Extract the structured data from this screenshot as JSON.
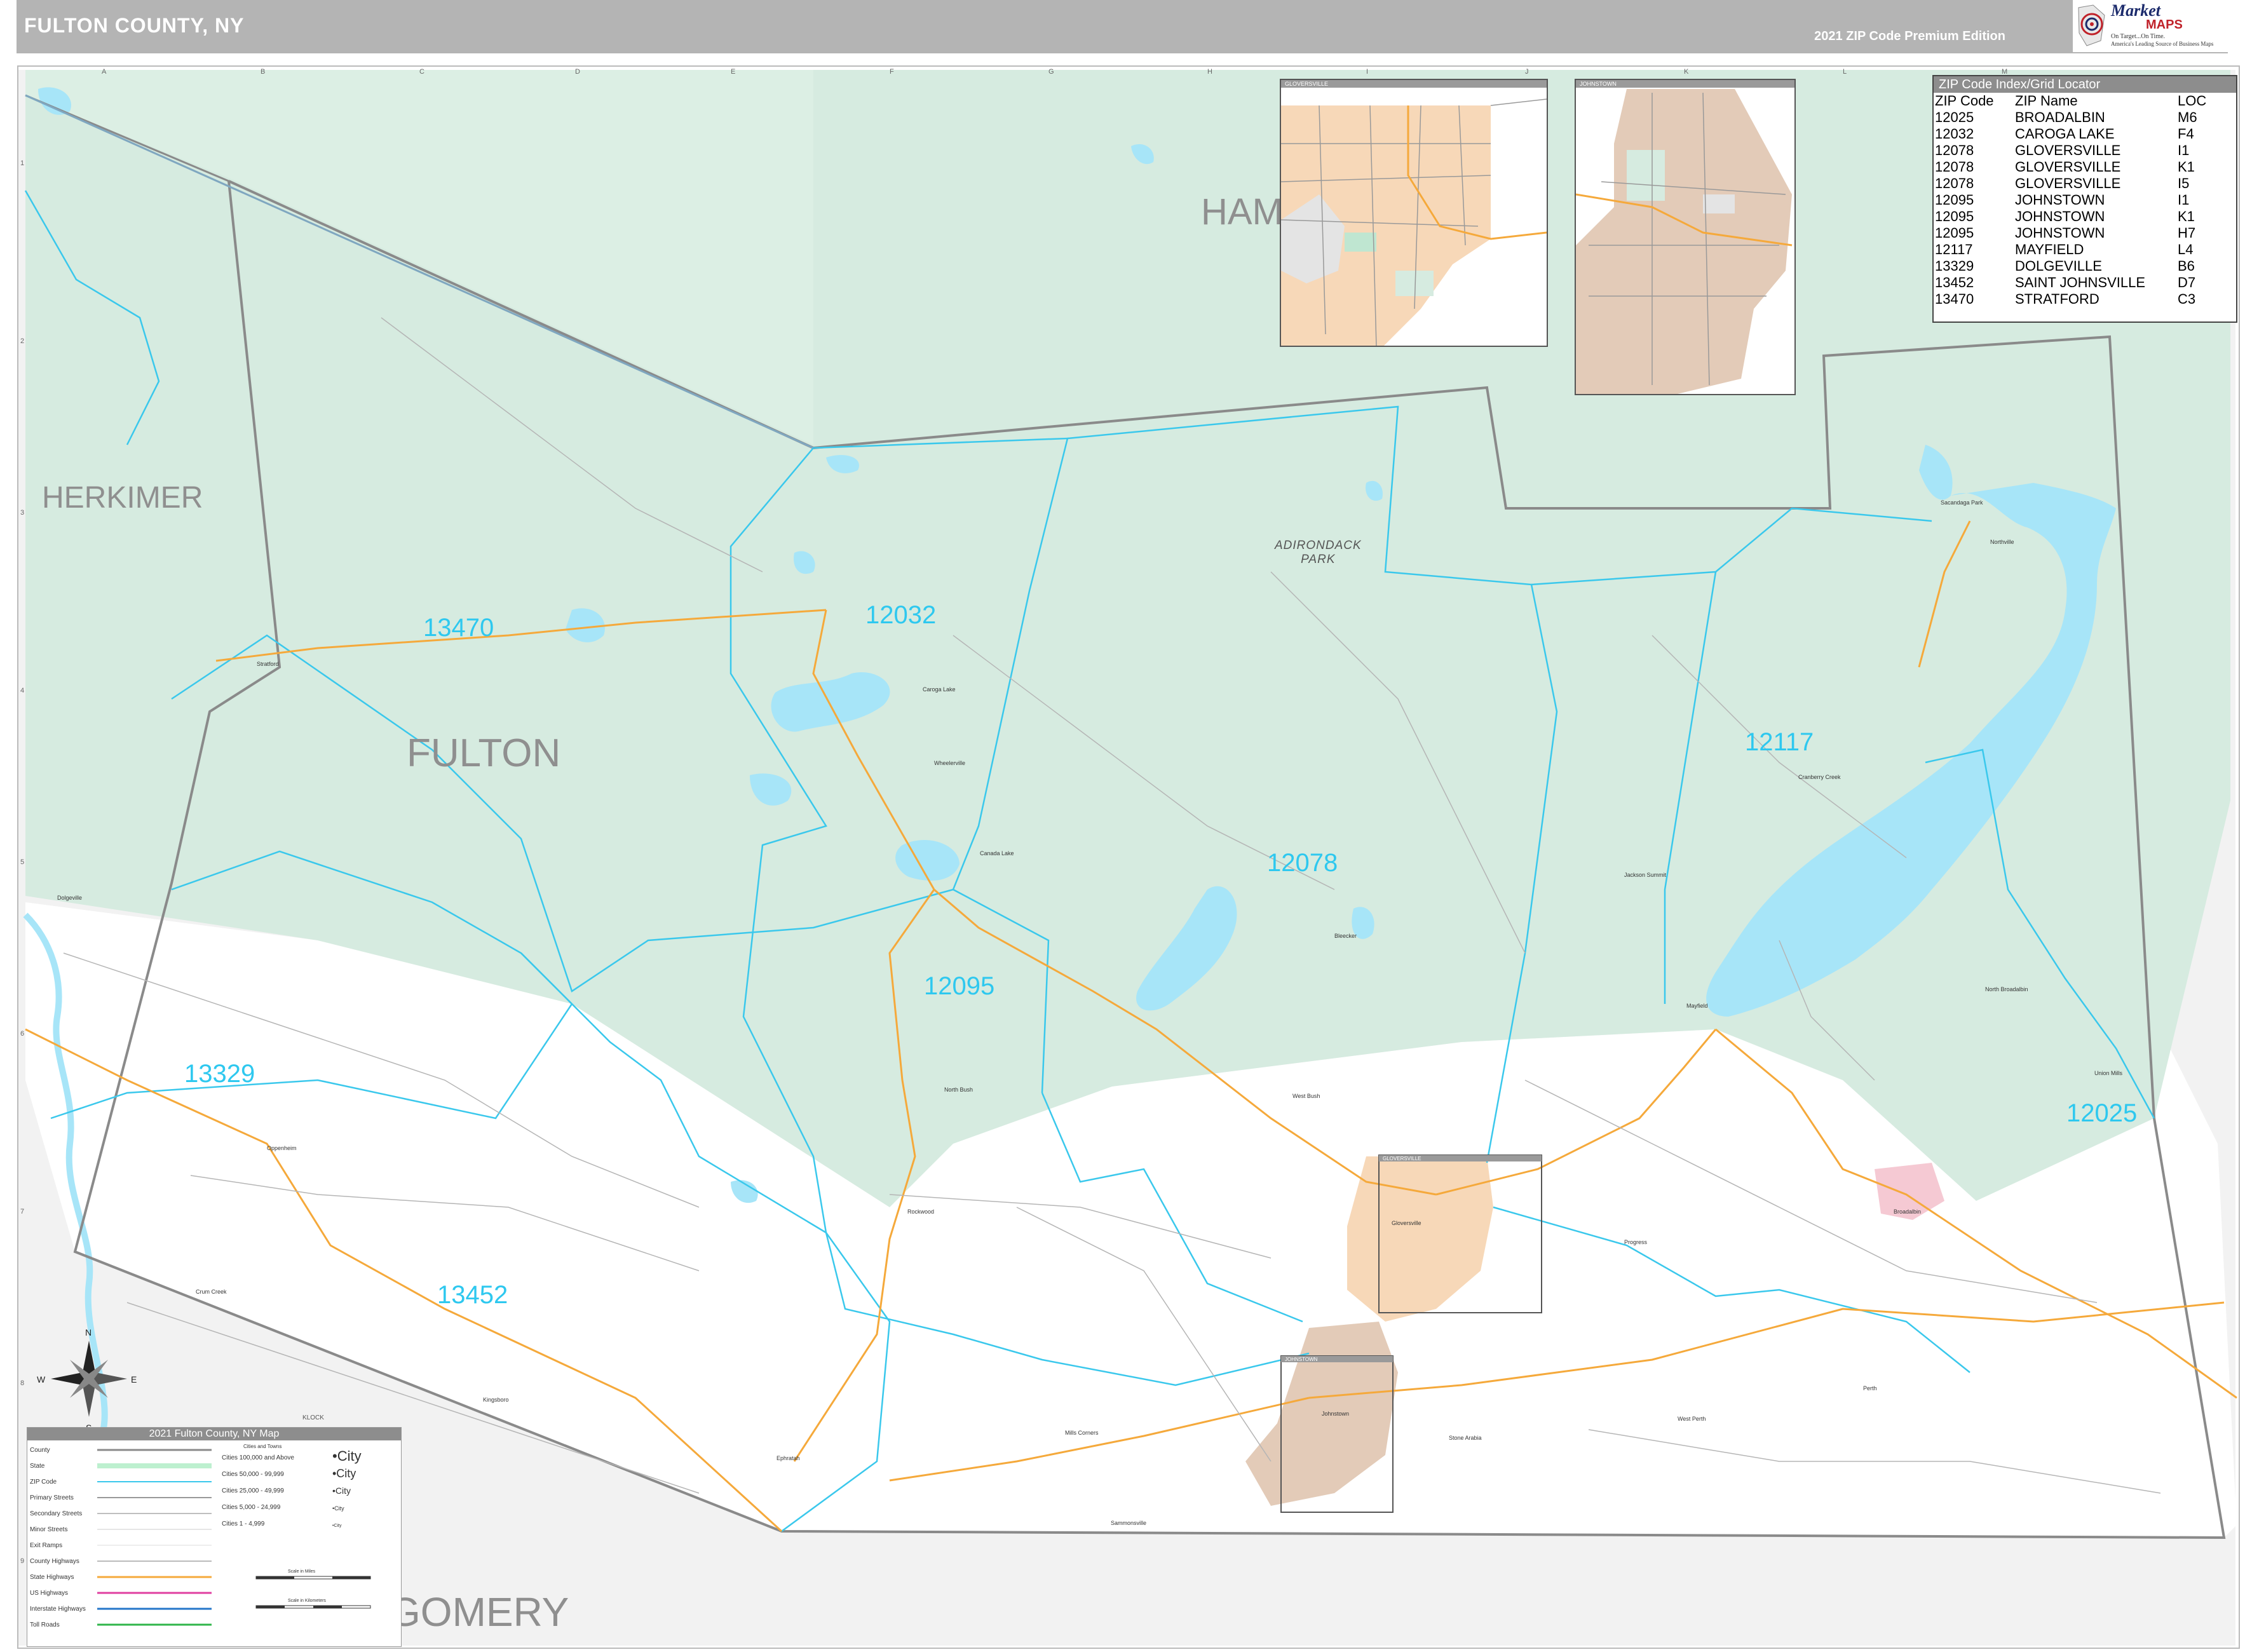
{
  "header": {
    "title": "FULTON COUNTY, NY",
    "edition": "2021 ZIP Code Premium Edition"
  },
  "logo": {
    "brand_top": "Market",
    "brand_bottom": "MAPS",
    "tagline_1": "On Target...On Time.",
    "tagline_2": "America's Leading Source of Business Maps",
    "icon": "target-map-icon"
  },
  "colors": {
    "adirondack_park": "#d6ebe0",
    "water": "#a7e5f8",
    "zip_boundary": "#3ac8ec",
    "zip_label": "#2ec8ef",
    "county_boundary": "#8a8a8a",
    "city_fill": "#f7d8b8",
    "city_fill_alt": "#e3cbb8",
    "county_label": "#8f8f8f",
    "header_bg": "#b4b4b4"
  },
  "grid": {
    "columns": [
      "A",
      "B",
      "C",
      "D",
      "E",
      "F",
      "G",
      "H",
      "I",
      "J",
      "K",
      "L",
      "M"
    ],
    "rows": [
      "1",
      "2",
      "3",
      "4",
      "5",
      "6",
      "7",
      "8",
      "9"
    ]
  },
  "counties": [
    {
      "name": "FULTON"
    },
    {
      "name": "HERKIMER"
    },
    {
      "name": "HAM"
    },
    {
      "name": "GOMERY"
    }
  ],
  "park_label": [
    "ADIRONDACK",
    "PARK"
  ],
  "zip_codes": [
    {
      "zip": "13470"
    },
    {
      "zip": "12032"
    },
    {
      "zip": "12117"
    },
    {
      "zip": "12078"
    },
    {
      "zip": "12095"
    },
    {
      "zip": "13329"
    },
    {
      "zip": "13452"
    },
    {
      "zip": "12025"
    }
  ],
  "places": [
    {
      "name": "Stratford"
    },
    {
      "name": "Caroga Lake"
    },
    {
      "name": "Wheelerville"
    },
    {
      "name": "Canada Lake"
    },
    {
      "name": "North Bush"
    },
    {
      "name": "West Bush"
    },
    {
      "name": "Rockwood"
    },
    {
      "name": "Ephratah"
    },
    {
      "name": "Oppenheim"
    },
    {
      "name": "Crum Creek"
    },
    {
      "name": "Mayfield"
    },
    {
      "name": "Broadalbin"
    },
    {
      "name": "Northville"
    },
    {
      "name": "Jackson Summit"
    },
    {
      "name": "Cranberry Creek"
    },
    {
      "name": "North Broadalbin"
    },
    {
      "name": "Union Mills"
    },
    {
      "name": "Sacandaga Park"
    },
    {
      "name": "Gloversville"
    },
    {
      "name": "Johnstown"
    },
    {
      "name": "Perth"
    },
    {
      "name": "West Perth"
    },
    {
      "name": "Progress"
    },
    {
      "name": "Kingsboro"
    },
    {
      "name": "Mills Corners"
    },
    {
      "name": "Sammonsville"
    },
    {
      "name": "Bleecker"
    },
    {
      "name": "Dolgeville"
    },
    {
      "name": "Stone Arabia"
    }
  ],
  "zip_index": {
    "title": "ZIP Code Index/Grid Locator",
    "headers": [
      "ZIP Code",
      "ZIP Name",
      "LOC"
    ],
    "rows": [
      [
        "12025",
        "BROADALBIN",
        "M6"
      ],
      [
        "12032",
        "CAROGA LAKE",
        "F4"
      ],
      [
        "12078",
        "GLOVERSVILLE",
        "I1"
      ],
      [
        "12078",
        "GLOVERSVILLE",
        "K1"
      ],
      [
        "12078",
        "GLOVERSVILLE",
        "I5"
      ],
      [
        "12095",
        "JOHNSTOWN",
        "I1"
      ],
      [
        "12095",
        "JOHNSTOWN",
        "K1"
      ],
      [
        "12095",
        "JOHNSTOWN",
        "H7"
      ],
      [
        "12117",
        "MAYFIELD",
        "L4"
      ],
      [
        "13329",
        "DOLGEVILLE",
        "B6"
      ],
      [
        "13452",
        "SAINT JOHNSVILLE",
        "D7"
      ],
      [
        "13470",
        "STRATFORD",
        "C3"
      ]
    ]
  },
  "insets": [
    {
      "title": "GLOVERSVILLE"
    },
    {
      "title": "JOHNSTOWN"
    }
  ],
  "locator_boxes": [
    {
      "title": "GLOVERSVILLE"
    },
    {
      "title": "JOHNSTOWN"
    }
  ],
  "legend": {
    "title": "2021 Fulton County, NY Map",
    "line_items": [
      "County",
      "State",
      "ZIP Code",
      "Primary Streets",
      "Secondary Streets",
      "Minor Streets",
      "Exit Ramps",
      "County Highways",
      "State Highways",
      "US Highways",
      "Interstate Highways",
      "Toll Roads"
    ],
    "cities_header": "Cities and Towns",
    "city_classes": [
      {
        "range": "Cities 100,000 and Above",
        "sample": "•City"
      },
      {
        "range": "Cities 50,000 - 99,999",
        "sample": "•City"
      },
      {
        "range": "Cities 25,000 - 49,999",
        "sample": "•City"
      },
      {
        "range": "Cities 5,000 - 24,999",
        "sample": "•City"
      },
      {
        "range": "Cities 1 - 4,999",
        "sample": "•City"
      }
    ],
    "scale_miles": "Scale in Miles",
    "scale_km": "Scale in Kilometers"
  },
  "compass": {
    "n": "N",
    "s": "S",
    "e": "E",
    "w": "W"
  },
  "klock_label": "KLOCK"
}
